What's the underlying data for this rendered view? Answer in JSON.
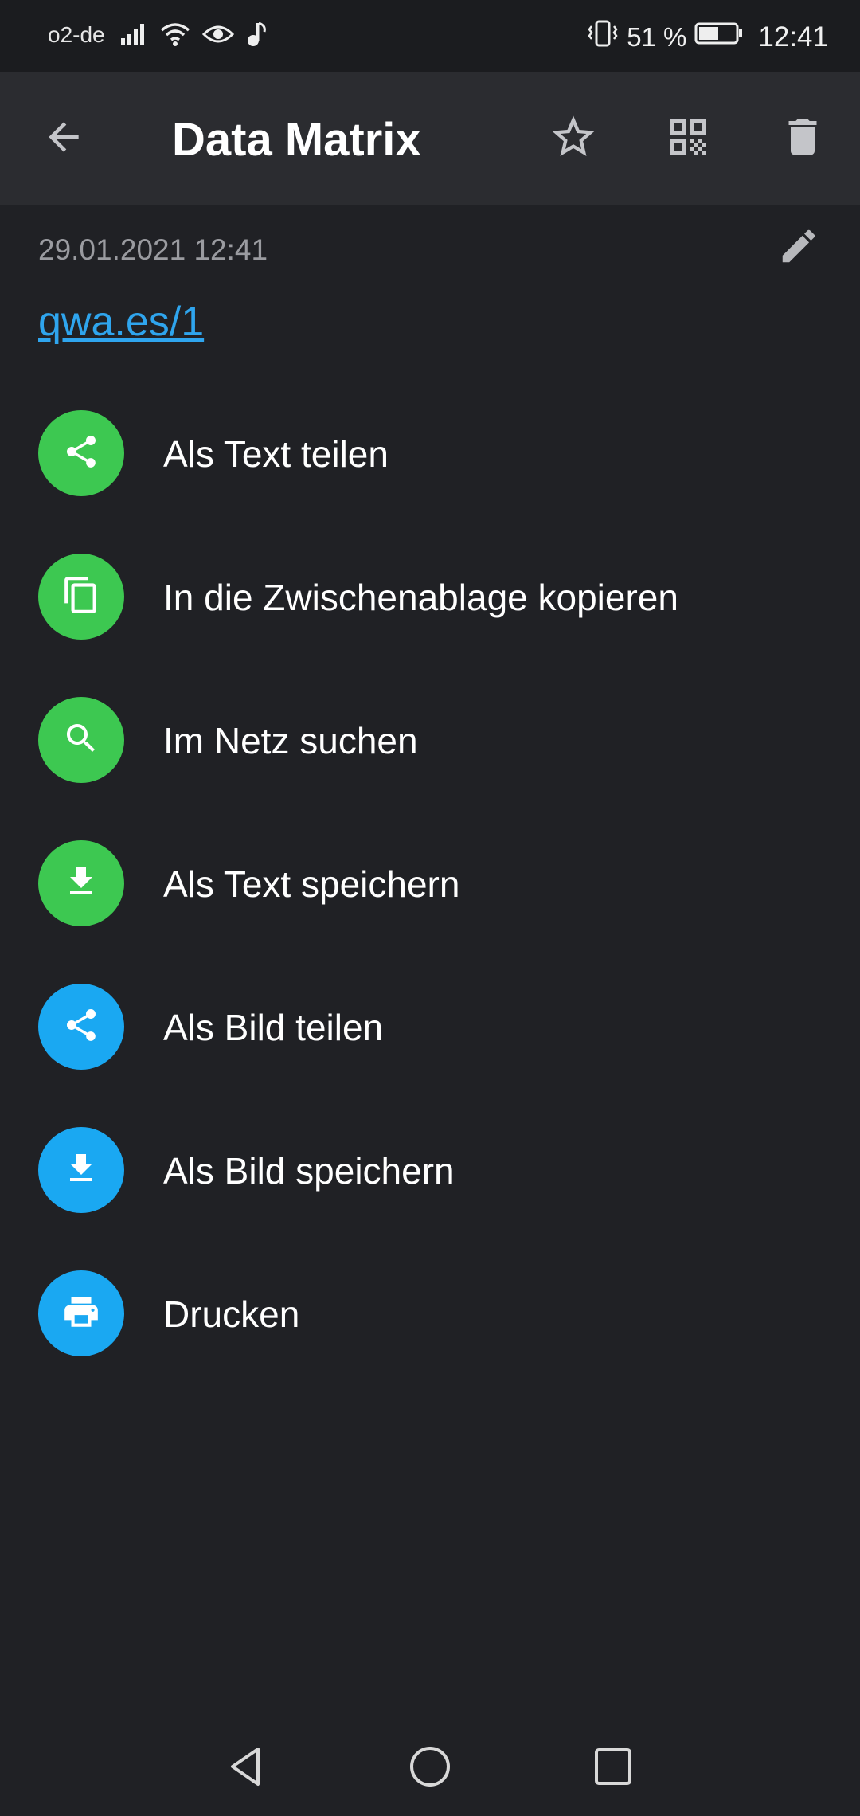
{
  "status_bar": {
    "carrier": "o2-de",
    "battery_percent": "51 %",
    "time": "12:41",
    "icons": [
      "signal-icon",
      "wifi-icon",
      "eye-icon",
      "music-note-icon",
      "vibrate-icon",
      "battery-icon"
    ]
  },
  "app_bar": {
    "title": "Data Matrix",
    "icons": [
      "back-arrow-icon",
      "star-icon",
      "qr-code-icon",
      "delete-icon"
    ]
  },
  "content": {
    "timestamp": "29.01.2021 12:41",
    "link": "qwa.es/1",
    "edit_icon": "pencil-icon"
  },
  "actions": [
    {
      "label": "Als Text teilen",
      "icon": "share-icon",
      "color": "#3dc851"
    },
    {
      "label": "In die Zwischenablage kopieren",
      "icon": "copy-icon",
      "color": "#3dc851"
    },
    {
      "label": "Im Netz suchen",
      "icon": "search-icon",
      "color": "#3dc851"
    },
    {
      "label": "Als Text speichern",
      "icon": "download-icon",
      "color": "#3dc851"
    },
    {
      "label": "Als Bild teilen",
      "icon": "share-icon",
      "color": "#1aa8f2"
    },
    {
      "label": "Als Bild speichern",
      "icon": "download-icon",
      "color": "#1aa8f2"
    },
    {
      "label": "Drucken",
      "icon": "print-icon",
      "color": "#1aa8f2"
    }
  ],
  "nav_bar": {
    "icons": [
      "nav-back-icon",
      "nav-home-icon",
      "nav-recents-icon"
    ]
  },
  "colors": {
    "background": "#202125",
    "app_bar": "#2b2c30",
    "link": "#2fa5ee",
    "green": "#3dc851",
    "blue": "#1aa8f2"
  }
}
